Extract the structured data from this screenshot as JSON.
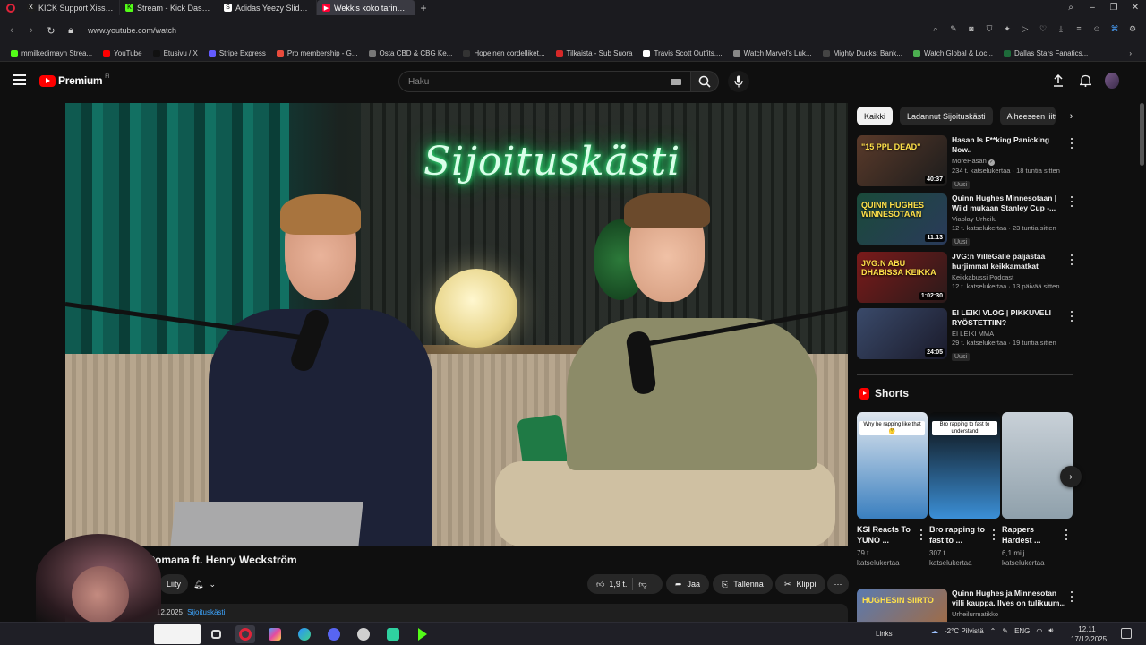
{
  "browser": {
    "tabs": [
      {
        "label": "KICK Support Xissä: \"chec",
        "icon_color": "#1d1d1d",
        "icon_glyph": "X"
      },
      {
        "label": "Stream - Kick Dashboard",
        "icon_color": "#53fc18",
        "icon_glyph": "K"
      },
      {
        "label": "Adidas Yeezy Slide Azure",
        "icon_color": "#ffffff",
        "icon_glyph": "S"
      },
      {
        "label": "Wekkis koko tarina sensuroi",
        "icon_color": "#ff0033",
        "icon_glyph": "▶"
      }
    ],
    "url": "www.youtube.com/watch",
    "bookmarks": [
      {
        "label": "mmilkedimayn Strea...",
        "color": "#53fc18"
      },
      {
        "label": "YouTube",
        "color": "#ff0000"
      },
      {
        "label": "Etusivu / X",
        "color": "#111111"
      },
      {
        "label": "Stripe Express",
        "color": "#635bff"
      },
      {
        "label": "Pro membership - G...",
        "color": "#e94b3c"
      },
      {
        "label": "Osta CBD & CBG Ke...",
        "color": "#777777"
      },
      {
        "label": "Hopeinen cordelliket...",
        "color": "#333333"
      },
      {
        "label": "Tilkaista - Sub Suora",
        "color": "#d62828"
      },
      {
        "label": "Travis Scott Outfits,...",
        "color": "#ffffff"
      },
      {
        "label": "Watch Marvel's Luk...",
        "color": "#888888"
      },
      {
        "label": "Mighty Ducks: Bank...",
        "color": "#444444"
      },
      {
        "label": "Watch Global & Loc...",
        "color": "#4caf50"
      },
      {
        "label": "Dallas Stars Fanatics...",
        "color": "#1e6b3a"
      }
    ]
  },
  "youtube": {
    "logo_text": "Premium",
    "logo_sup": "FI",
    "search_placeholder": "Haku"
  },
  "video": {
    "neon_sign": "Sijoituskästi",
    "title": "W       e sensuroimattomana ft. Henry Weckström",
    "join_label": "Liity",
    "likes": "1,9 t.",
    "share_label": "Jaa",
    "save_label": "Tallenna",
    "clip_label": "Klippi",
    "date": "12.2025",
    "hashtag": "Sijoituskästi"
  },
  "chips": [
    "Kaikki",
    "Ladannut Sijoituskästi",
    "Aiheeseen liitt"
  ],
  "recommendations": [
    {
      "title": "Hasan Is F**king Panicking Now..",
      "channel": "MoreHasan",
      "verified": true,
      "meta": "234 t. katselukertaa · 18 tuntia sitten",
      "badge": "Uusi",
      "duration": "40:37",
      "thumb_overlay": "\"15 PPL DEAD\"",
      "thumb_colors": [
        "#5a3a2a",
        "#1c1c1c"
      ]
    },
    {
      "title": "Quinn Hughes Minnesotaan | Wild mukaan Stanley Cup -...",
      "channel": "Viaplay Urheilu",
      "verified": false,
      "meta": "12 t. katselukertaa · 23 tuntia sitten",
      "badge": "Uusi",
      "duration": "11:13",
      "thumb_overlay": "QUINN HUGHES WINNESOTAAN",
      "thumb_colors": [
        "#1a4a3a",
        "#2a3a5a"
      ]
    },
    {
      "title": "JVG:n VilleGalle paljastaa hurjimmat keikkamatkat",
      "channel": "Keikkabussi Podcast",
      "verified": false,
      "meta": "12 t. katselukertaa · 13 päivää sitten",
      "badge": "",
      "duration": "1:02:30",
      "thumb_overlay": "JVG:N ABU DHABISSA KEIKKA",
      "thumb_colors": [
        "#7a1a1a",
        "#2a1a1a"
      ]
    },
    {
      "title": "EI LEIKI VLOG | PIKKUVELI RYÖSTETTIIN?",
      "channel": "EI LEIKI MMA",
      "verified": false,
      "meta": "29 t. katselukertaa · 19 tuntia sitten",
      "badge": "Uusi",
      "duration": "24:05",
      "thumb_overlay": "",
      "thumb_colors": [
        "#3a4a6a",
        "#1a1a2a"
      ]
    }
  ],
  "shorts": {
    "heading": "Shorts",
    "items": [
      {
        "title": "KSI Reacts To YUNO ...",
        "views": "79 t. katselukertaa",
        "thumb_colors": [
          "#dfe6ee",
          "#3a7fbf"
        ],
        "caption": "Why be rapping like that 🤔"
      },
      {
        "title": "Bro rapping to fast to ...",
        "views": "307 t. katselukertaa",
        "thumb_colors": [
          "#0b0b0b",
          "#3b8fd6"
        ],
        "caption": "Bro rapping to fast to understand"
      },
      {
        "title": "Rappers Hardest ...",
        "views": "6,1 milj. katselukertaa",
        "thumb_colors": [
          "#c9d1d8",
          "#8fa0ab"
        ],
        "caption": ""
      }
    ]
  },
  "bottom_rec": {
    "title": "Quinn Hughes ja Minnesotan villi kauppa. Ilves on tulikuum...",
    "channel": "Urheilurmatikko",
    "thumb_overlay": "HUGHESIN SIIRTO"
  },
  "taskbar": {
    "links_label": "Links",
    "weather": "-2°C  Pilvistä",
    "lang": "ENG",
    "time": "12.11",
    "date": "17/12/2025"
  },
  "colors": {
    "accent_red": "#ff0000",
    "bg": "#0f0f0f",
    "link_blue": "#3ea6ff"
  }
}
